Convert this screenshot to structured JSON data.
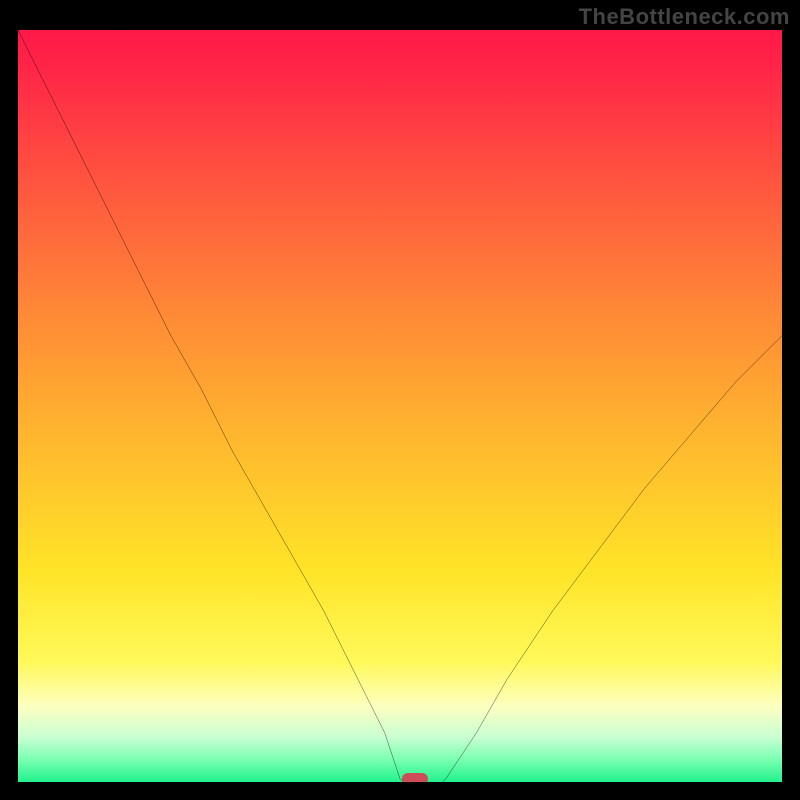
{
  "watermark": "TheBottleneck.com",
  "chart_data": {
    "type": "line",
    "title": "",
    "xlabel": "",
    "ylabel": "",
    "xlim": [
      0,
      100
    ],
    "ylim": [
      0,
      100
    ],
    "grid": false,
    "curve_description": "bottleneck percentage curve descending sharply from top-left to a minimum near x≈52, then rising toward the right",
    "x": [
      0,
      4,
      8,
      12,
      16,
      20,
      24,
      28,
      32,
      36,
      40,
      44,
      48,
      50,
      52,
      54,
      56,
      60,
      64,
      70,
      76,
      82,
      88,
      94,
      100
    ],
    "y": [
      100,
      92,
      84,
      76,
      68,
      60,
      53,
      45,
      38,
      31,
      24,
      16,
      8,
      2,
      0,
      0,
      2,
      8,
      15,
      24,
      32,
      40,
      47,
      54,
      60
    ],
    "minimum_marker": {
      "x": 52,
      "y": 0,
      "color": "#cf4b57"
    },
    "background_gradient": {
      "top": "#ff1848",
      "bottom": "#22f28e",
      "style": "red-to-green vertical gradient"
    }
  }
}
